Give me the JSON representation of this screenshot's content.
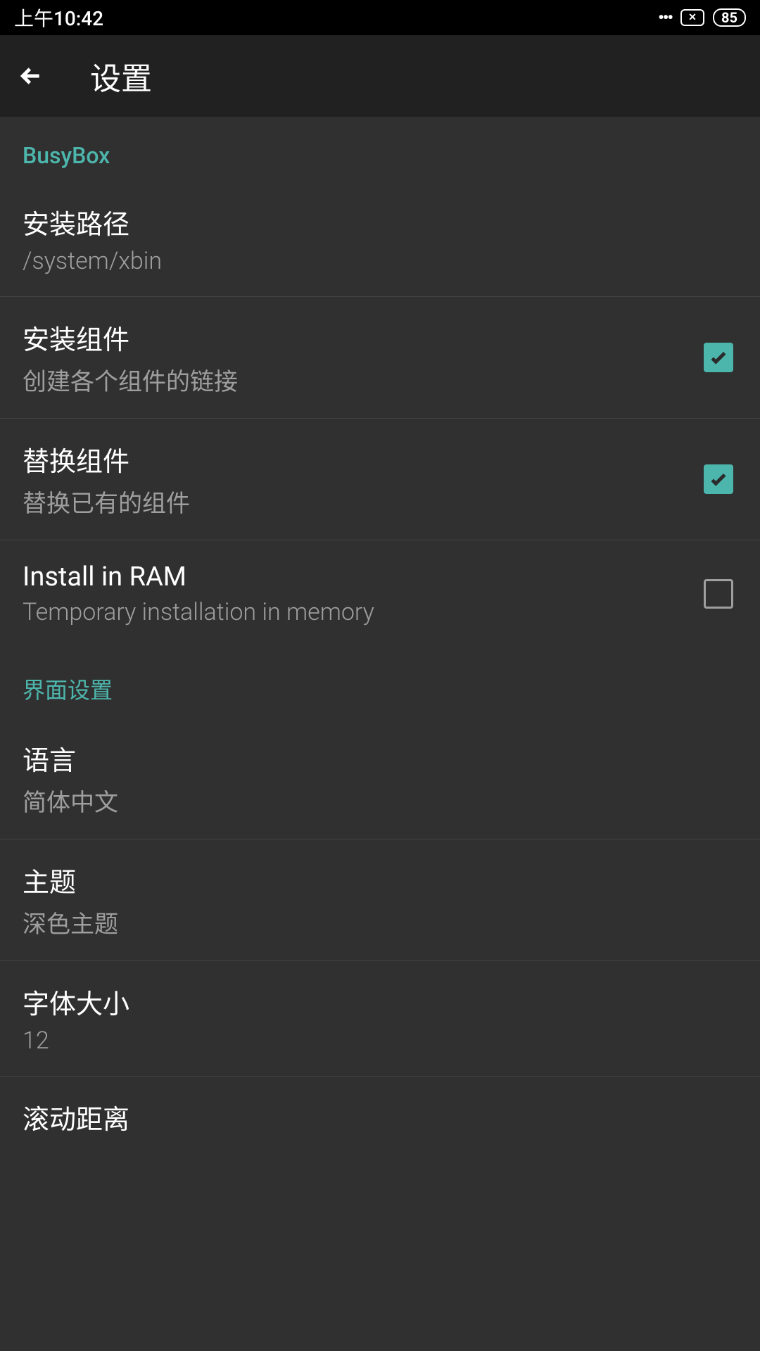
{
  "status": {
    "time": "上午10:42",
    "battery": "85"
  },
  "appbar": {
    "title": "设置"
  },
  "sections": {
    "busybox": {
      "header": "BusyBox",
      "install_path": {
        "title": "安装路径",
        "value": "/system/xbin"
      },
      "install_component": {
        "title": "安装组件",
        "subtitle": "创建各个组件的链接",
        "checked": true
      },
      "replace_component": {
        "title": "替换组件",
        "subtitle": "替换已有的组件",
        "checked": true
      },
      "install_ram": {
        "title": "Install in RAM",
        "subtitle": "Temporary installation in memory",
        "checked": false
      }
    },
    "interface": {
      "header": "界面设置",
      "language": {
        "title": "语言",
        "value": "简体中文"
      },
      "theme": {
        "title": "主题",
        "value": "深色主题"
      },
      "font_size": {
        "title": "字体大小",
        "value": "12"
      },
      "scroll_distance": {
        "title": "滚动距离"
      }
    }
  }
}
